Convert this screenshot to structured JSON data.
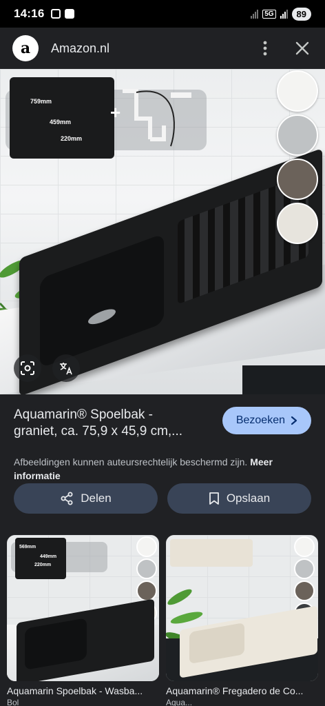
{
  "status_bar": {
    "time": "14:16",
    "network": "5G",
    "battery": "89"
  },
  "header": {
    "site_name": "Amazon.nl",
    "logo_letter": "a",
    "more_icon": "more-vert-icon",
    "close_icon": "close-icon"
  },
  "main_image": {
    "dim_width": "759mm",
    "dim_width2": "459mm",
    "dim_height": "220mm",
    "swatch_colors": [
      "#f4f4f2",
      "#bfc2c4",
      "#6b625a",
      "#e7e4dd"
    ]
  },
  "product": {
    "title": "Aquamarin® Spoelbak - graniet, ca. 75,9 x 45,9 cm,...",
    "visit_label": "Bezoeken",
    "disclaimer": "Afbeeldingen kunnen auteursrechtelijk beschermd zijn.",
    "more_info": "Meer informatie"
  },
  "actions": {
    "share_label": "Delen",
    "save_label": "Opslaan"
  },
  "related": [
    {
      "title": "Aquamarin Spoelbak - Wasba...",
      "source": "Bol",
      "dims": [
        "569mm",
        "449mm",
        "220mm"
      ]
    },
    {
      "title": "Aquamarin® Fregadero de Co...",
      "source": "Aqua..."
    }
  ]
}
